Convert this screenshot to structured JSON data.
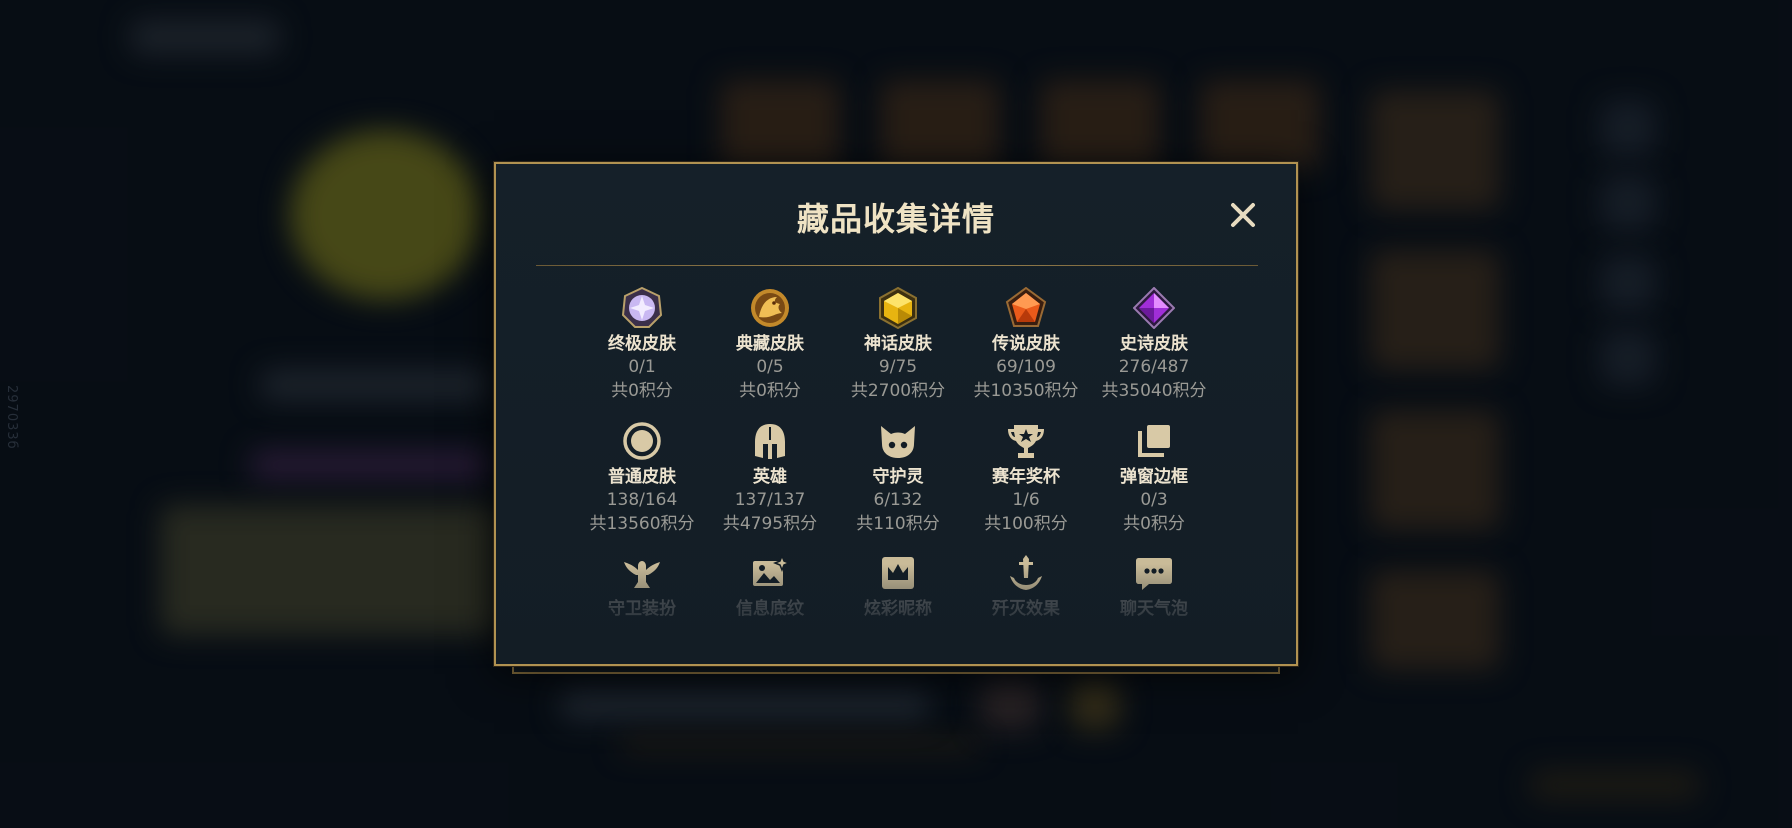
{
  "background": {
    "side_id": "297033б"
  },
  "modal": {
    "title": "藏品收集详情",
    "close_label": "✕"
  },
  "categories": [
    {
      "name": "终极皮肤",
      "count": "0/1",
      "points": "共0积分",
      "icon": "ultimate-gem-icon",
      "color": "#c9b8f2"
    },
    {
      "name": "典藏皮肤",
      "count": "0/5",
      "points": "共0积分",
      "icon": "dragon-emblem-icon",
      "color": "#e0a53a"
    },
    {
      "name": "神话皮肤",
      "count": "9/75",
      "points": "共2700积分",
      "icon": "mythic-gem-icon",
      "color": "#f2c21b"
    },
    {
      "name": "传说皮肤",
      "count": "69/109",
      "points": "共10350积分",
      "icon": "legendary-gem-icon",
      "color": "#f06a1c"
    },
    {
      "name": "史诗皮肤",
      "count": "276/487",
      "points": "共35040积分",
      "icon": "epic-gem-icon",
      "color": "#b23fe0"
    },
    {
      "name": "普通皮肤",
      "count": "138/164",
      "points": "共13560积分",
      "icon": "circle-icon",
      "color": "#d8c9a6"
    },
    {
      "name": "英雄",
      "count": "137/137",
      "points": "共4795积分",
      "icon": "helmet-icon",
      "color": "#d8c9a6"
    },
    {
      "name": "守护灵",
      "count": "6/132",
      "points": "共110积分",
      "icon": "cat-face-icon",
      "color": "#d8c9a6"
    },
    {
      "name": "赛年奖杯",
      "count": "1/6",
      "points": "共100积分",
      "icon": "trophy-icon",
      "color": "#d8c9a6"
    },
    {
      "name": "弹窗边框",
      "count": "0/3",
      "points": "共0积分",
      "icon": "stacked-frames-icon",
      "color": "#d8c9a6"
    },
    {
      "name": "守卫装扮",
      "icon": "ward-icon",
      "color": "#c9bb98"
    },
    {
      "name": "信息底纹",
      "icon": "image-sparkle-icon",
      "color": "#c9bb98"
    },
    {
      "name": "炫彩昵称",
      "icon": "crown-card-icon",
      "color": "#c9bb98"
    },
    {
      "name": "歼灭效果",
      "icon": "sword-anchor-icon",
      "color": "#c9bb98"
    },
    {
      "name": "聊天气泡",
      "icon": "chat-bubble-icon",
      "color": "#c9bb98"
    }
  ]
}
